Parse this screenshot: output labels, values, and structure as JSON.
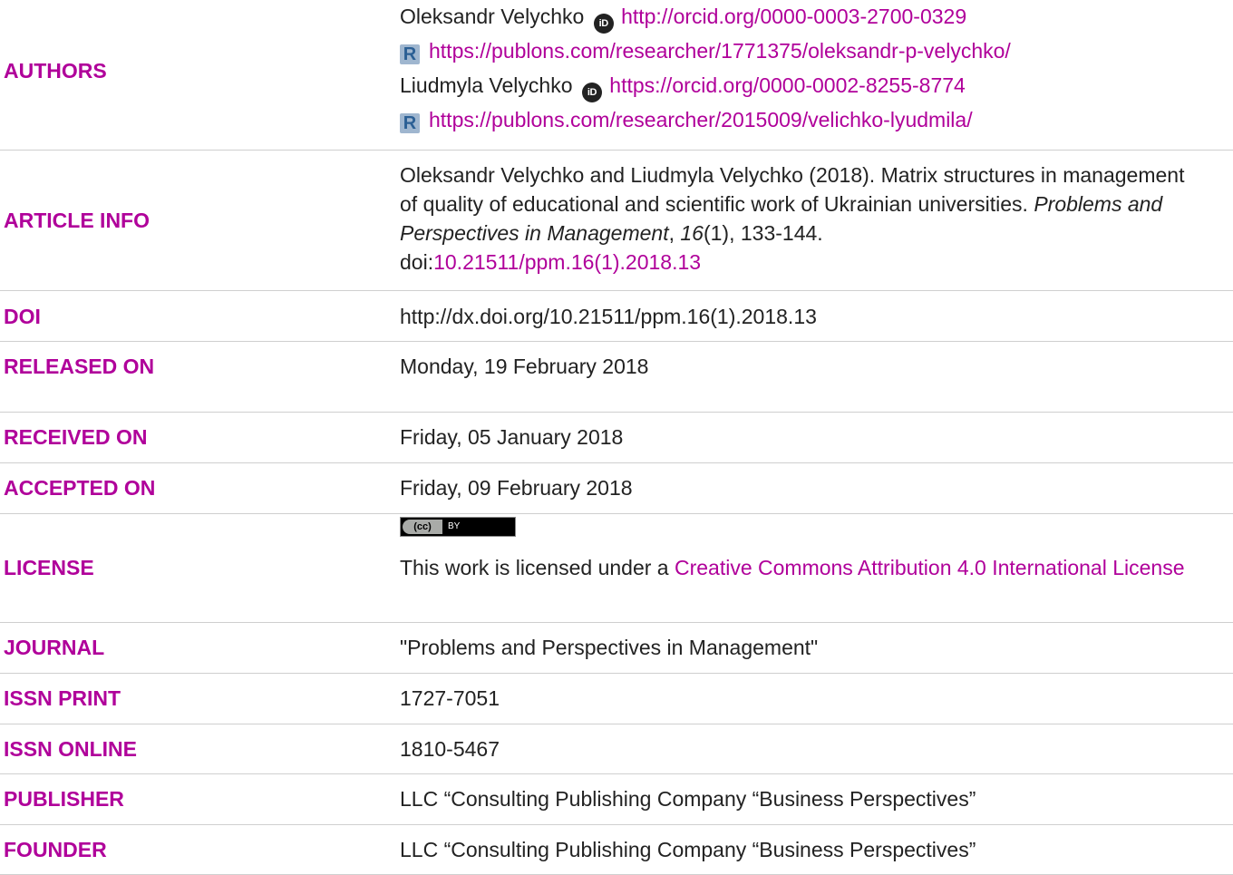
{
  "rows": {
    "authors": {
      "label": "AUTHORS",
      "lines": [
        {
          "name": "Oleksandr Velychko",
          "link": "http://orcid.org/0000-0003-2700-0329"
        },
        {
          "link": "https://publons.com/researcher/1771375/oleksandr-p-velychko/"
        },
        {
          "name": "Liudmyla Velychko",
          "link": "https://orcid.org/0000-0002-8255-8774"
        },
        {
          "link": "https://publons.com/researcher/2015009/velichko-lyudmila/"
        }
      ]
    },
    "article_info": {
      "label": "ARTICLE INFO",
      "text_1": "Oleksandr Velychko and Liudmyla Velychko (2018). Matrix structures in management of quality of educational and scientific work of Ukrainian universities. ",
      "journal_italic": "Problems and Perspectives in Management",
      "comma": ", ",
      "volume_italic": "16",
      "text_2": "(1), 133-144.",
      "doi_prefix": "doi:",
      "doi_link": "10.21511/ppm.16(1).2018.13"
    },
    "doi": {
      "label": "DOI",
      "value": "http://dx.doi.org/10.21511/ppm.16(1).2018.13"
    },
    "released_on": {
      "label": "RELEASED ON",
      "value": "Monday, 19 February 2018"
    },
    "received_on": {
      "label": "RECEIVED ON",
      "value": "Friday, 05 January 2018"
    },
    "accepted_on": {
      "label": "ACCEPTED ON",
      "value": "Friday, 09 February 2018"
    },
    "license": {
      "label": "LICENSE",
      "badge_cc": "(cc)",
      "badge_by": "BY",
      "text": "This work is licensed under a ",
      "link": "Creative Commons Attribution 4.0 International License"
    },
    "journal": {
      "label": "JOURNAL",
      "value": "\"Problems and Perspectives in Management\""
    },
    "issn_print": {
      "label": "ISSN PRINT",
      "value": "1727-7051"
    },
    "issn_online": {
      "label": "ISSN ONLINE",
      "value": "1810-5467"
    },
    "publisher": {
      "label": "PUBLISHER",
      "value": "LLC “Consulting Publishing Company “Business Perspectives”"
    },
    "founder": {
      "label": "FOUNDER",
      "value": "LLC “Consulting Publishing Company “Business Perspectives”"
    }
  },
  "icons": {
    "orcid": "orcid-icon",
    "publons": "publons-icon",
    "cc": "cc-by-badge"
  },
  "colors": {
    "label": "#b0009a",
    "link": "#b0009a",
    "text": "#222222",
    "divider": "#cfcfcf"
  }
}
